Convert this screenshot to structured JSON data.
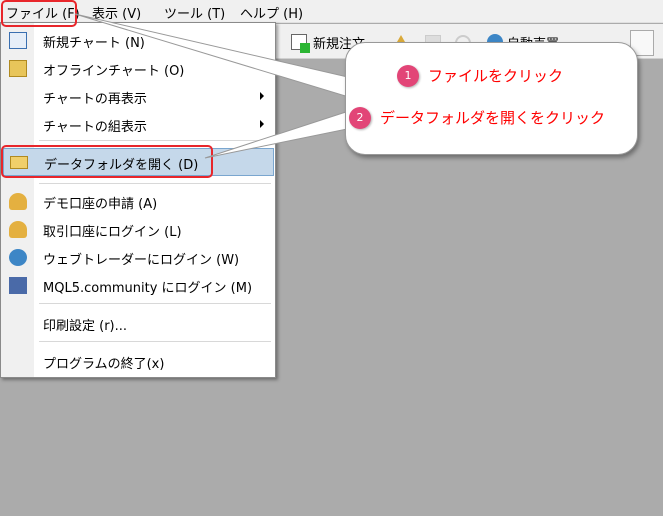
{
  "menubar": {
    "items": [
      "ファイル (F)",
      "表示 (V)",
      "ツール (T)",
      "ヘルプ (H)"
    ]
  },
  "toolbar": {
    "new_order": "新規注文",
    "auto_trading": "自動売買"
  },
  "file_menu": {
    "items": [
      {
        "label": "新規チャート (N)",
        "icon": "new-chart-icon"
      },
      {
        "label": "オフラインチャート (O)",
        "icon": "offline-chart-icon"
      },
      {
        "label": "チャートの再表示",
        "submenu": true
      },
      {
        "label": "チャートの組表示",
        "submenu": true
      },
      {
        "label": "データフォルダを開く (D)",
        "icon": "folder-icon",
        "highlighted": true
      },
      {
        "label": "デモ口座の申請 (A)",
        "icon": "user-add-icon"
      },
      {
        "label": "取引口座にログイン (L)",
        "icon": "user-login-icon"
      },
      {
        "label": "ウェブトレーダーにログイン (W)",
        "icon": "globe-login-icon"
      },
      {
        "label": "MQL5.community にログイン (M)",
        "icon": "mql5-login-icon"
      },
      {
        "label": "印刷設定 (r)..."
      },
      {
        "label": "プログラムの終了(x)"
      }
    ]
  },
  "callout": {
    "steps": [
      {
        "num": "1",
        "text": "ファイルをクリック"
      },
      {
        "num": "2",
        "text": "データフォルダを開くをクリック"
      }
    ]
  },
  "colors": {
    "accent": "#e8262b",
    "badge": "#e24577",
    "highlight": "#c5d8ea"
  }
}
